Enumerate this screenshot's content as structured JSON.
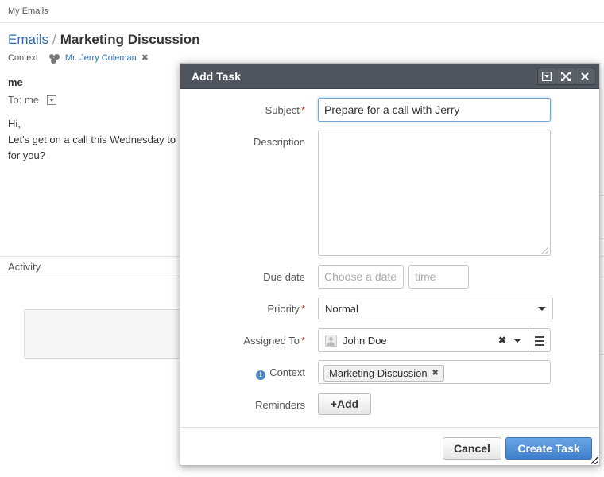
{
  "topbar": {
    "link": "My Emails"
  },
  "breadcrumb": {
    "parent": "Emails",
    "separator": "/",
    "title": "Marketing Discussion"
  },
  "context": {
    "label": "Context",
    "person": "Mr. Jerry Coleman"
  },
  "email": {
    "sender": "me",
    "to_label": "To: me",
    "line1": "Hi,",
    "line2": "Let's get on a call this Wednesday to",
    "line3": "for you?"
  },
  "activity": {
    "label": "Activity"
  },
  "dialog": {
    "title": "Add Task",
    "fields": {
      "subject_label": "Subject",
      "subject_value": "Prepare for a call with Jerry",
      "description_label": "Description",
      "description_value": "",
      "due_date_label": "Due date",
      "date_placeholder": "Choose a date",
      "time_placeholder": "time",
      "priority_label": "Priority",
      "priority_value": "Normal",
      "assigned_label": "Assigned To",
      "assigned_value": "John Doe",
      "context_label": "Context",
      "context_tag": "Marketing Discussion",
      "reminders_label": "Reminders",
      "add_button": "+Add"
    },
    "required_mark": "*",
    "footer": {
      "cancel": "Cancel",
      "create": "Create Task"
    }
  },
  "colors": {
    "header_bg": "#4f555e",
    "link": "#2a6ab0",
    "primary": "#3f7fcc",
    "required": "#c0392b"
  }
}
